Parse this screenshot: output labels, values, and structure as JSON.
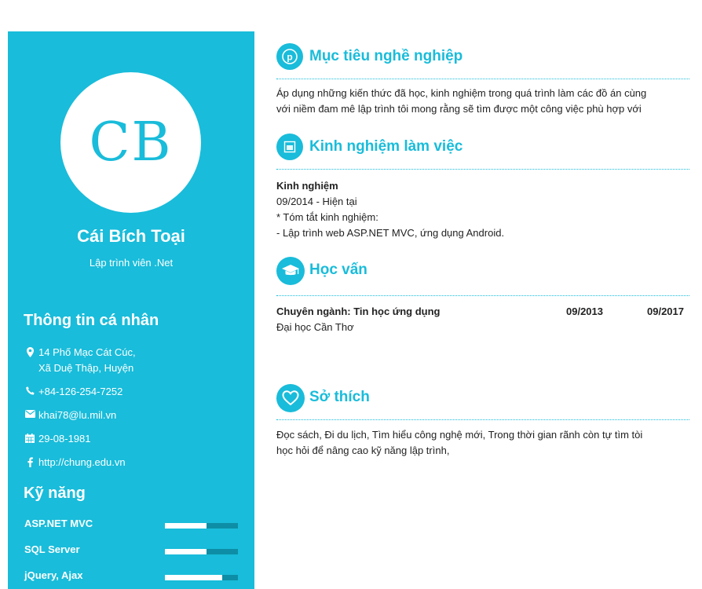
{
  "profile": {
    "initials": "CB",
    "name": "Cái Bích Toại",
    "job_title": "Lập trình viên .Net"
  },
  "personal_info": {
    "heading": "Thông tin cá nhân",
    "address_line1": "14 Phố Mạc Cát Cúc,",
    "address_line2": "Xã Duệ Thập, Huyện",
    "phone": "+84-126-254-7252",
    "email": "khai78@lu.mil.vn",
    "birthday": "29-08-1981",
    "website": "http://chung.edu.vn"
  },
  "skills": {
    "heading": "Kỹ năng",
    "items": [
      {
        "label": "ASP.NET MVC",
        "level": 0.57
      },
      {
        "label": "SQL Server",
        "level": 0.57
      },
      {
        "label": "jQuery, Ajax",
        "level": 0.78
      }
    ]
  },
  "objective": {
    "title": "Mục tiêu nghề nghiệp",
    "line1": "Áp dụng những kiến thức đã học, kinh nghiệm trong quá trình làm các đồ án cùng",
    "line2": "với niềm đam mê lập trình tôi mong rằng sẽ tìm được một công việc phù hợp với"
  },
  "experience": {
    "title": "Kinh nghiệm làm việc",
    "role": "Kinh nghiệm",
    "period": "09/2014 - Hiện tại",
    "summary_label": "* Tóm tắt kinh nghiệm:",
    "detail": "- Lập trình web ASP.NET MVC, ứng dụng Android."
  },
  "education": {
    "title": "Học vấn",
    "major": "Chuyên ngành: Tin học ứng dụng",
    "start": "09/2013",
    "end": "09/2017",
    "school": "Đại học Cần Thơ"
  },
  "hobbies": {
    "title": "Sở thích",
    "line1": "Đọc sách, Đi du lịch, Tìm hiểu công nghệ mới, Trong thời gian rãnh còn tự tìm tòi",
    "line2": "học hỏi để nâng cao kỹ năng lập trình,"
  },
  "colors": {
    "accent": "#19bcda",
    "bar_track": "#0d8ea6",
    "bar_fill": "#ffffff"
  }
}
